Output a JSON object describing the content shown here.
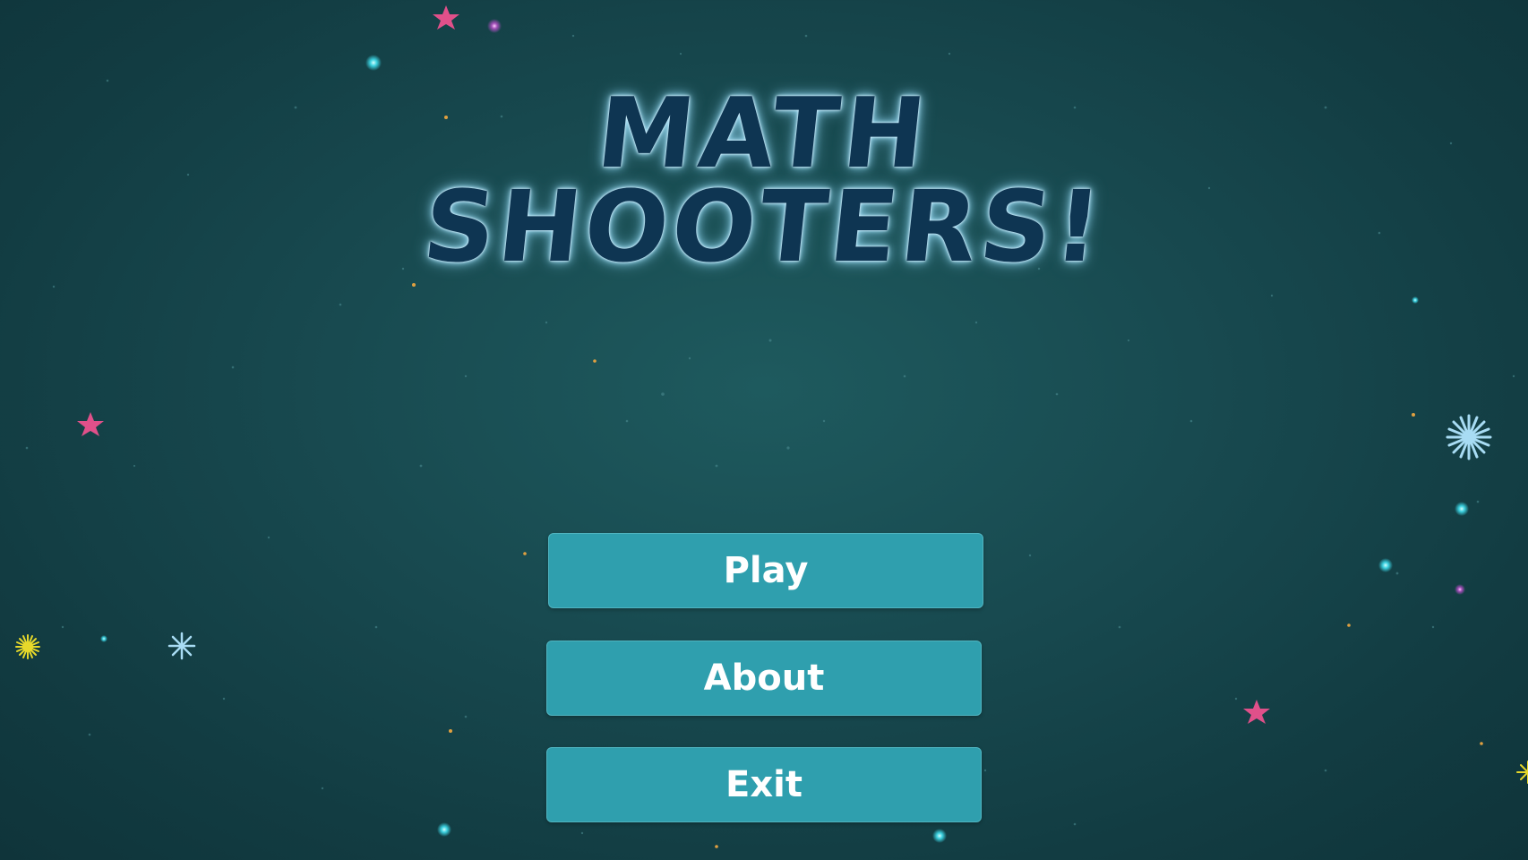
{
  "title": {
    "line1": "MATH",
    "line2": "SHOOTERS!"
  },
  "menu": {
    "play_label": "Play",
    "about_label": "About",
    "exit_label": "Exit"
  },
  "colors": {
    "background": "#164a50",
    "button": "#2f9fae",
    "button_text": "#ffffff",
    "title_fill": "#0e3552",
    "title_glow": "#8fd4ee",
    "pink_star": "#e0508a",
    "blue_star": "#9fd8f0",
    "yellow_star": "#e6d82a"
  },
  "decorations": [
    "pink-star-icon",
    "blue-sparkle-icon",
    "yellow-burst-icon",
    "cyan-dot-icon"
  ]
}
